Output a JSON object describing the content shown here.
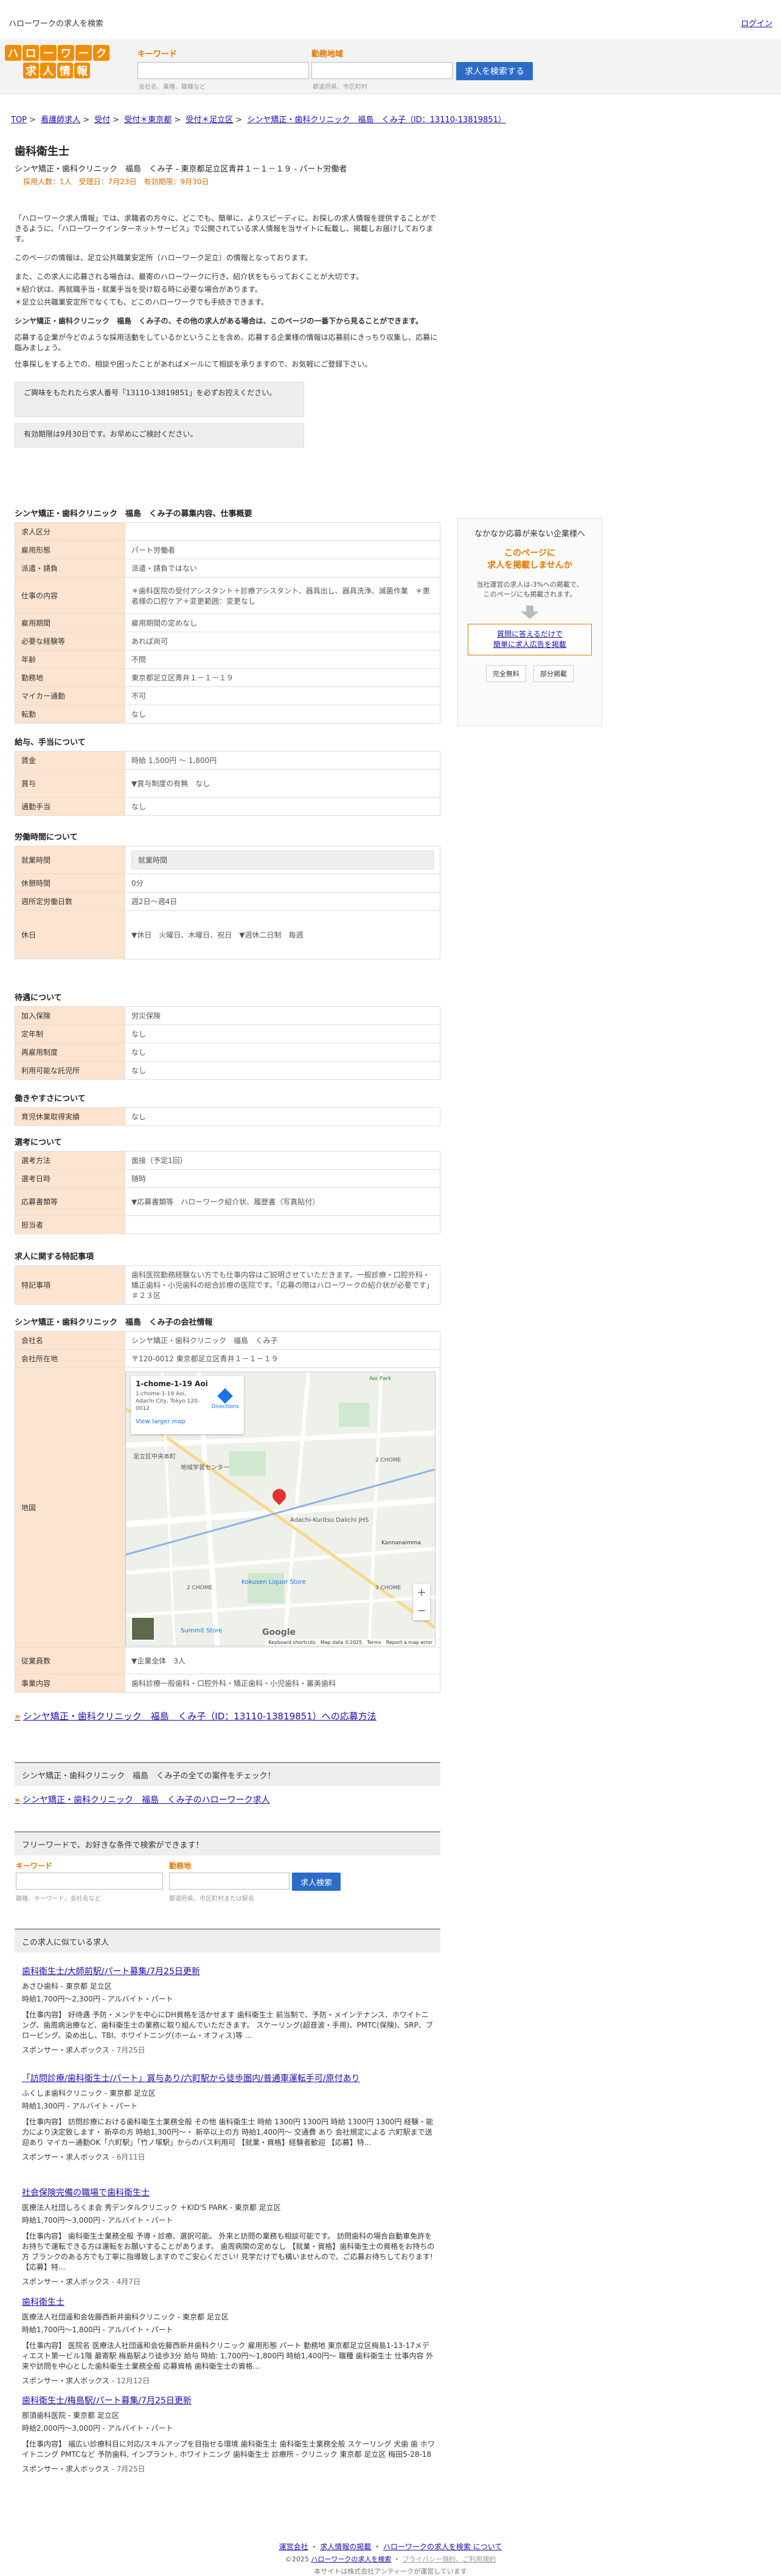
{
  "topbar": {
    "site_title": "ハローワークの求人を検索",
    "login": "ログイン"
  },
  "logo": {
    "line1": [
      "ハ",
      "ロ",
      "ー",
      "ワ",
      "ー",
      "ク"
    ],
    "line2": [
      "求",
      "人",
      "情",
      "報"
    ]
  },
  "search": {
    "keyword_label": "キーワード",
    "keyword_hint": "会社名、業種、職種など",
    "location_label": "勤務地域",
    "location_hint": "都道府県、市区町村",
    "button": "求人を検索する"
  },
  "breadcrumb": [
    "TOP",
    "看護師求人",
    "受付",
    "受付＊東京都",
    "受付＊足立区",
    "シンヤ矯正・歯科クリニック　福島　くみ子（ID：13110-13819851）"
  ],
  "job": {
    "title": "歯科衛生士",
    "subtitle": "シンヤ矯正・歯科クリニック　福島　くみ子 - 東京都足立区青井１－１－１９ - パート労働者",
    "meta": "採用人数：1人　受理日：7月23日　有効期限：9月30日"
  },
  "intro": [
    "「ハローワーク求人情報」では、求職者の方々に、どこでも、簡単に、よりスピーディに、お探しの求人情報を提供することができるように、「ハローワークインターネットサービス」で公開されている求人情報を当サイトに転載し、掲載しお届けしております。",
    "このページの情報は、足立公共職業安定所（ハローワーク足立）の情報となっております。",
    "また、この求人に応募される場合は、最寄のハローワークに行き、紹介状をもらっておくことが大切です。",
    "＊紹介状は、再就職手当・就業手当を受け取る時に必要な場合があります。",
    "＊足立公共職業安定所でなくても、どこのハローワークでも手続きできます。",
    "シンヤ矯正・歯科クリニック　福島　くみ子の、その他の求人がある場合は、このページの一番下から見ることができます。",
    "応募する企業が今どのような採用活動をしているかということを含め、応募する企業様の情報は応募前にきっちり収集し、応募に臨みましょう。",
    "仕事探しをする上での、相談や困ったことがあればメールにて相談を承りますので、お気軽にご登録下さい。"
  ],
  "notes": [
    "ご興味をもたれたら求人番号「13110-13819851」を必ずお控えください。",
    "有効期限は9月30日です。お早めにご検討ください。"
  ],
  "sections": {
    "overview": {
      "title": "シンヤ矯正・歯科クリニック　福島　くみ子の募集内容、仕事概要",
      "rows": [
        [
          "求人区分",
          ""
        ],
        [
          "雇用形態",
          "パート労働者"
        ],
        [
          "派遣・請負",
          "派遣・請負ではない"
        ],
        [
          "仕事の内容",
          "＊歯科医院の受付アシスタント＋診療アシスタント、器具出し、器具洗浄、滅菌作業　＊患者様の口腔ケア＋変更範囲：変更なし"
        ],
        [
          "雇用期間",
          "雇用期間の定めなし"
        ],
        [
          "必要な経験等",
          "あれば尚可"
        ],
        [
          "年齢",
          "不問"
        ],
        [
          "勤務地",
          "東京都足立区青井１－１－１９"
        ],
        [
          "マイカー通勤",
          "不可"
        ],
        [
          "転勤",
          "なし"
        ]
      ]
    },
    "pay": {
      "title": "給与、手当について",
      "rows": [
        [
          "賃金",
          "時給 1,500円 ～ 1,800円"
        ],
        [
          "賞与",
          "▼賞与制度の有無　なし"
        ],
        [
          "通勤手当",
          "なし"
        ]
      ]
    },
    "hours": {
      "title": "労働時間について",
      "rows": [
        [
          "就業時間",
          "就業時間"
        ],
        [
          "休憩時間",
          "0分"
        ],
        [
          "週所定労働日数",
          "週2日～週4日"
        ],
        [
          "休日",
          "▼休日　火曜日、木曜日、祝日　▼週休二日制　毎週"
        ]
      ]
    },
    "benefits": {
      "title": "待遇について",
      "rows": [
        [
          "加入保険",
          "労災保険"
        ],
        [
          "定年制",
          "なし"
        ],
        [
          "再雇用制度",
          "なし"
        ],
        [
          "利用可能な託児所",
          "なし"
        ]
      ]
    },
    "ease": {
      "title": "働きやすさについて",
      "rows": [
        [
          "育児休業取得実績",
          "なし"
        ]
      ]
    },
    "apply": {
      "title": "選考について",
      "rows": [
        [
          "選考方法",
          "面接（予定1回）"
        ],
        [
          "選考日時",
          "随時"
        ],
        [
          "応募書類等",
          "▼応募書類等　ハローワーク紹介状、履歴書（写真貼付）"
        ],
        [
          "担当者",
          ""
        ]
      ]
    },
    "special": {
      "title": "求人に関する特記事項",
      "rows": [
        [
          "特記事項",
          "歯科医院勤務経験ない方でも仕事内容はご説明させていただきます。一般診療・口腔外科・矯正歯科・小児歯科の総合診療の医院です。「応募の際はハローワークの紹介状が必要です」＃２３区"
        ]
      ]
    },
    "company": {
      "title": "シンヤ矯正・歯科クリニック　福島　くみ子の会社情報",
      "rows": [
        [
          "会社名",
          "シンヤ矯正・歯科クリニック　福島　くみ子"
        ],
        [
          "会社所在地",
          "〒120-0012 東京都足立区青井１－１－１９"
        ],
        [
          "地図",
          ""
        ],
        [
          "従業員数",
          "▼企業全体　3人"
        ],
        [
          "事業内容",
          "歯科診療一般歯科・口腔外科・矯正歯科・小児歯科・審美歯科"
        ]
      ]
    }
  },
  "map": {
    "address_title": "1-chome-1-19 Aoi",
    "address_sub": "1-chome-1-19 Aoi, Adachi City, Tokyo 120-0012",
    "directions": "Directions",
    "larger": "View larger map",
    "labels": [
      "足立区中央本町",
      "地域学習センター",
      "2 CHOME",
      "Adachi-Kuritsu Daiichi JHS",
      "2 CHOME",
      "Kokusen Liquor Store",
      "3 CHOME",
      "Summit Store",
      "Kannanaimma",
      "Aoi Park"
    ],
    "footer": [
      "Keyboard shortcuts",
      "Map data ©2025",
      "Terms",
      "Report a map error"
    ],
    "google": "Google"
  },
  "apply_link": "シンヤ矯正・歯科クリニック　福島　くみ子（ID：13110-13819851）への応募方法",
  "all_jobs": {
    "head": "シンヤ矯正・歯科クリニック　福島　くみ子の全ての案件をチェック！",
    "link": "シンヤ矯正・歯科クリニック　福島　くみ子のハローワーク求人"
  },
  "free_search": {
    "head": "フリーワードで、お好きな条件で検索ができます！",
    "keyword_label": "キーワード",
    "keyword_hint": "職種、キーワード、会社名など",
    "location_label": "勤務地",
    "location_hint": "都道府県、市区町村または駅名",
    "button": "求人検索"
  },
  "related": {
    "head": "この求人に似ている求人",
    "jobs": [
      {
        "title": "歯科衛生士/大師前駅/パート募集/7月25日更新",
        "company": "あさひ歯科 - 東京都 足立区",
        "wage": "時給1,700円〜2,300円 - アルバイト・パート",
        "desc": "【仕事内容】 好待遇 予防・メンテを中心にDH資格を活かせます 歯科衛生士 前当制で、予防・メインテナンス、ホワイトニング、歯周病治療など、歯科衛生士の業務に取り組んでいただきます。 スケーリング(超音波・手用)、PMTC(保険)、SRP、ブロービング、染め出し、TBI、ホワイトニング(ホーム・オフィス)等 ...",
        "sponsor": "スポンサー・求人ボックス",
        "date": "7月25日"
      },
      {
        "title": "「訪問診療/歯科衛生士/パート」賞与あり/六町駅から徒歩圏内/普通車運転手可/原付あり",
        "company": "ふくしま歯科クリニック - 東京都 足立区",
        "wage": "時給1,300円 - アルバイト・パート",
        "desc": "【仕事内容】 訪問診療における歯科衛生士業務全般 その他 歯科衛生士 時給 1300円 1300円 時給 1300円 1300円 経験・能力により決定致します・ 新卒の方 時給1,300円〜・ 新卒以上の方 時給1,400円〜 交通費 あり 会社規定による 六町駅まで送迎あり マイカー通勤OK「六町駅」「竹ノ塚駅」からのバス利用可 【就業・資格】経験者歓迎 【応募】特...",
        "sponsor": "スポンサー・求人ボックス",
        "date": "6月11日"
      },
      {
        "title": "社会保険完備の職場で歯科衛生士",
        "company": "医療法人社団しろくま会 秀デンタルクリニック ＋KID'S PARK - 東京都 足立区",
        "wage": "時給1,700円〜3,000円 - アルバイト・パート",
        "desc": "【仕事内容】 歯科衛生士業務全般 予導・診療、選択可能。 外来と訪問の業務も相談可能です。 訪問歯科の場合自動車免許をお持ちで運転できる方は運転をお願いすることがあります。 歯周病関の定めなし 【就業・資格】歯科衛生士の資格をお持ちの方 ブランクのある方でも丁寧に指導致しますのでご安心ください! 見学だけでも構いませんので、ご応募お待ちしております! 【応募】特...",
        "sponsor": "スポンサー・求人ボックス",
        "date": "4月7日"
      },
      {
        "title": "歯科衛生士",
        "company": "医療法人社団遥和会佐藤西新井歯科クリニック - 東京都 足立区",
        "wage": "時給1,700円〜1,800円 - アルバイト・パート",
        "desc": "【仕事内容】 医院名 医療法人社団遥和会佐藤西新井歯科クリニック 雇用形態 パート 勤務地 東京都足立区梅島1-13-17メディエスト第一ビル1階 最寄駅 梅島駅より徒歩3分 給与 時給: 1,700円〜1,800円 時給1,400円〜 職種 歯科衛生士 仕事内容 外来や訪問を中心とした歯科衛生士業務全般 応募資格 歯科衛生士の資格...",
        "sponsor": "スポンサー・求人ボックス",
        "date": "12月12日"
      },
      {
        "title": "歯科衛生士/梅島駅/パート募集/7月25日更新",
        "company": "那須歯科医院 - 東京都 足立区",
        "wage": "時給2,000円〜3,000円 - アルバイト・パート",
        "desc": "【仕事内容】 福広い診療科目に対応/スキルアップを目指せる環境 歯科衛生士 歯科衛生士業務全般 スケーリング 犬歯 歯 ホワイトニング PMTCなど 予防歯科, インプラント, ホワイトニング 歯科衛生士 診療所 - クリニック 東京都 足立区 梅田5-28-18 ...",
        "sponsor": "スポンサー・求人ボックス",
        "date": "7月25日"
      }
    ]
  },
  "footer": {
    "links": [
      "運営会社",
      "求人情報の掲載",
      "ハローワークの求人を検索 について"
    ],
    "line2_a": "©2025",
    "line2_b": "ハローワークの求人を検索",
    "line2_c": "プライバシー規約、ご利用規約",
    "line3": "本サイトは株式会社アンティークが運営しています"
  }
}
